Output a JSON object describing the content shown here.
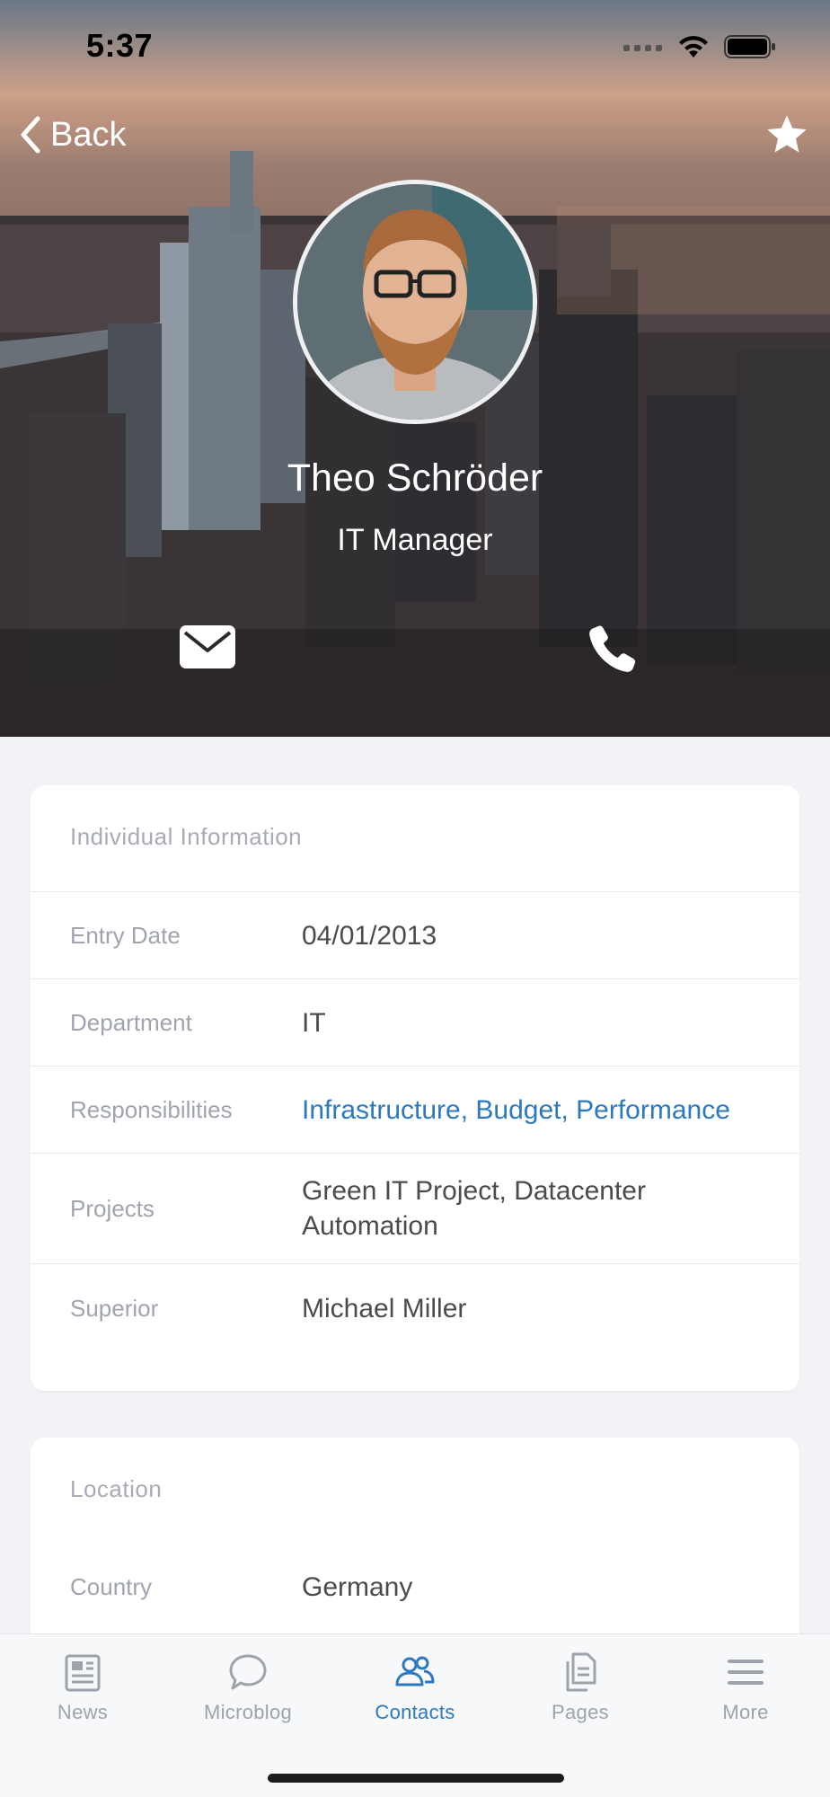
{
  "status_bar": {
    "time": "5:37"
  },
  "nav": {
    "back_label": "Back"
  },
  "profile": {
    "name": "Theo Schröder",
    "job_title": "IT Manager"
  },
  "individual_info": {
    "header": "Individual Information",
    "rows": [
      {
        "label": "Entry Date",
        "value": "04/01/2013"
      },
      {
        "label": "Department",
        "value": "IT"
      },
      {
        "label": "Responsibilities",
        "value": "Infrastructure, Budget, Performance"
      },
      {
        "label": "Projects",
        "value": "Green IT Project, Datacenter Automation"
      },
      {
        "label": "Superior",
        "value": "Michael Miller"
      }
    ]
  },
  "location": {
    "header": "Location",
    "rows": [
      {
        "label": "Country",
        "value": "Germany"
      }
    ]
  },
  "tabbar": {
    "tabs": [
      {
        "label": "News",
        "icon": "news-icon"
      },
      {
        "label": "Microblog",
        "icon": "microblog-icon"
      },
      {
        "label": "Contacts",
        "icon": "contacts-icon"
      },
      {
        "label": "Pages",
        "icon": "pages-icon"
      },
      {
        "label": "More",
        "icon": "more-icon"
      }
    ],
    "active": "Contacts"
  },
  "colors": {
    "accent": "#2d79bf",
    "label": "#a0a4ad",
    "background": "#f2f3f7"
  }
}
